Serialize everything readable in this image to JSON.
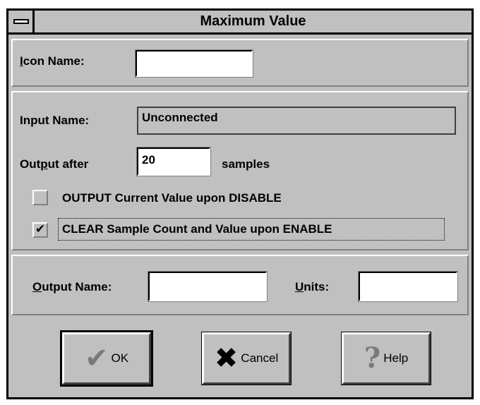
{
  "window": {
    "title": "Maximum Value"
  },
  "icon_section": {
    "label_prefix": "",
    "label_accel": "I",
    "label_rest": "con Name:",
    "value": ""
  },
  "input_section": {
    "input_label": "Input Name:",
    "input_value": "Unconnected",
    "output_after_pre": "Out",
    "output_after_accel": "p",
    "output_after_rest": "ut after",
    "samples_value": "20",
    "samples_label": "samples",
    "checkbox1_label": "OUTPUT Current Value upon DISABLE",
    "checkbox1_checked": false,
    "checkbox2_label": "CLEAR Sample Count and Value upon ENABLE",
    "checkbox2_checked": true,
    "check_glyph": "✔"
  },
  "output_section": {
    "output_name_accel": "O",
    "output_name_rest": "utput Name:",
    "output_name_value": "",
    "units_accel": "U",
    "units_rest": "nits:",
    "units_value": ""
  },
  "buttons": {
    "ok_label": "OK",
    "cancel_label": "Cancel",
    "help_label": "Help",
    "ok_icon": "✔",
    "cancel_icon": "✖",
    "help_icon": "?"
  }
}
